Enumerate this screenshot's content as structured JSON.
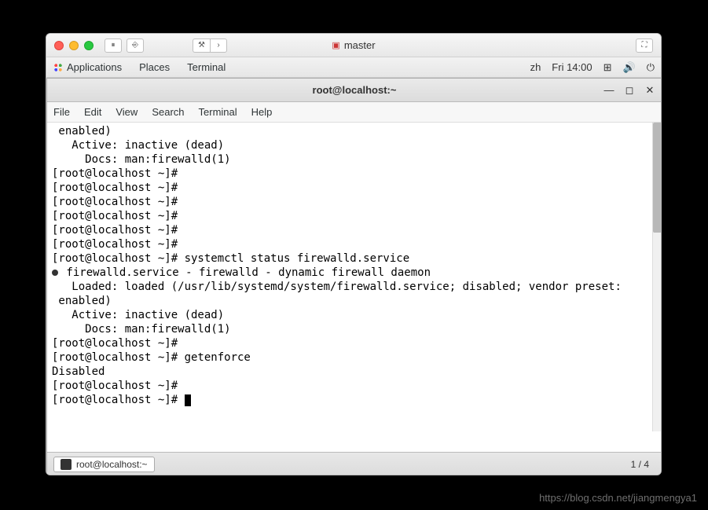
{
  "mac_titlebar": {
    "title": "master"
  },
  "gnome_panel": {
    "apps": "Applications",
    "places": "Places",
    "terminal": "Terminal",
    "lang": "zh",
    "clock": "Fri 14:00"
  },
  "term_window": {
    "title": "root@localhost:~",
    "menu": [
      "File",
      "Edit",
      "View",
      "Search",
      "Terminal",
      "Help"
    ]
  },
  "terminal_lines": [
    " enabled)",
    "   Active: inactive (dead)",
    "     Docs: man:firewalld(1)",
    "[root@localhost ~]# ",
    "[root@localhost ~]# ",
    "[root@localhost ~]# ",
    "[root@localhost ~]# ",
    "[root@localhost ~]# ",
    "[root@localhost ~]# ",
    "[root@localhost ~]# systemctl status firewalld.service",
    " firewalld.service - firewalld - dynamic firewall daemon",
    "   Loaded: loaded (/usr/lib/systemd/system/firewalld.service; disabled; vendor preset:",
    " enabled)",
    "   Active: inactive (dead)",
    "     Docs: man:firewalld(1)",
    "[root@localhost ~]# ",
    "[root@localhost ~]# getenforce",
    "Disabled",
    "[root@localhost ~]# ",
    "[root@localhost ~]# "
  ],
  "taskbar": {
    "task": "root@localhost:~",
    "workspace": "1 / 4"
  },
  "watermark": "https://blog.csdn.net/jiangmengya1"
}
